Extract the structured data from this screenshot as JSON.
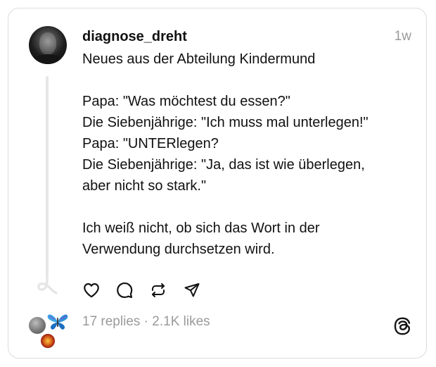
{
  "post": {
    "username": "diagnose_dreht",
    "timestamp": "1w",
    "body_lines": [
      "Neues aus der Abteilung Kindermund",
      "",
      "Papa: \"Was möchtest du essen?\"",
      "Die Siebenjährige: \"Ich muss mal unterlegen!\"",
      "Papa: \"UNTERlegen?",
      "Die Siebenjährige: \"Ja, das ist wie überlegen,",
      "aber nicht so stark.\"",
      "",
      "Ich weiß nicht, ob sich das Wort in der",
      "Verwendung durchsetzen wird."
    ],
    "stats": {
      "replies": "17 replies",
      "separator": " · ",
      "likes": "2.1K likes"
    }
  },
  "actions": {
    "like_icon": "heart-icon",
    "reply_icon": "comment-icon",
    "repost_icon": "repost-icon",
    "share_icon": "send-icon"
  },
  "branding": {
    "logo_icon": "threads-logo-icon"
  },
  "colors": {
    "text": "#111111",
    "muted": "#9a9a9a",
    "border": "#dcdcdc",
    "thread_line": "#e6e6e6",
    "background": "#ffffff"
  }
}
